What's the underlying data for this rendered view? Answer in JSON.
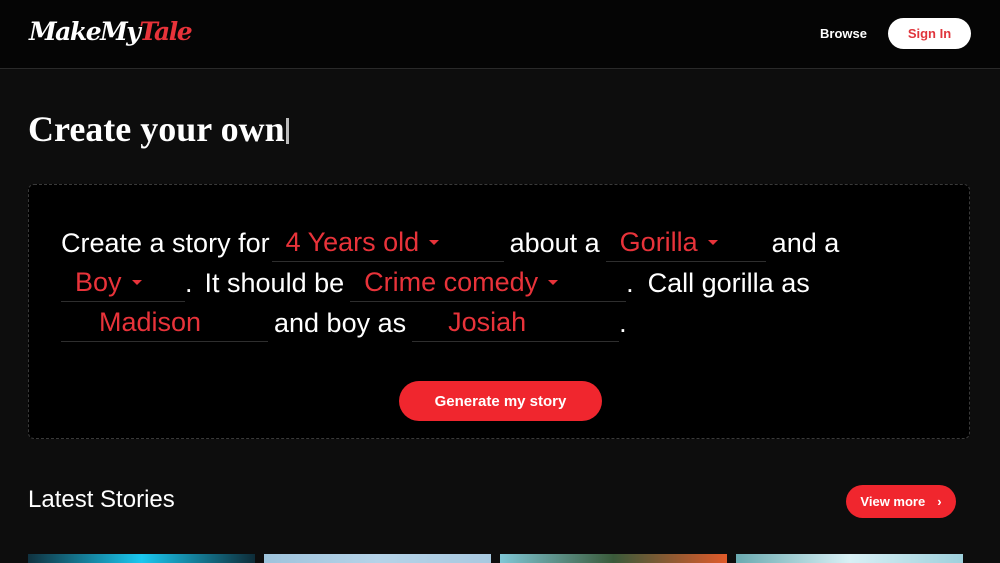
{
  "nav": {
    "logo_part1": "MakeMy",
    "logo_part2": "Tale",
    "browse": "Browse",
    "sign_in": "Sign In"
  },
  "hero": {
    "title": "Create your own"
  },
  "form": {
    "t1": "Create a story for",
    "age": "4 Years old",
    "t2": "about a",
    "animal": "Gorilla",
    "t3": "and a",
    "child": "Boy",
    "t4": ".",
    "t5": "It should be",
    "genre": "Crime comedy",
    "t6": ".",
    "t7": "Call  gorilla as",
    "animal_name": "Madison",
    "t8": "and boy as",
    "child_name": "Josiah",
    "t9": ".",
    "generate": "Generate my story"
  },
  "latest": {
    "title": "Latest Stories",
    "view_more": "View more",
    "thumbnails": [
      {
        "name": "story-1",
        "colors": [
          "#10323f",
          "#1ac8f0",
          "#0e2c38"
        ]
      },
      {
        "name": "story-2",
        "colors": [
          "#9ec3dc",
          "#b5d3e8",
          "#a8c9e0"
        ]
      },
      {
        "name": "story-3",
        "colors": [
          "#7fc7d6",
          "#3a5a3a",
          "#e05a2a"
        ]
      },
      {
        "name": "story-4",
        "colors": [
          "#6aaab0",
          "#d8f0f5",
          "#9ed0dc"
        ]
      }
    ]
  },
  "colors": {
    "accent": "#f0262e",
    "bg": "#0d0d0d"
  }
}
